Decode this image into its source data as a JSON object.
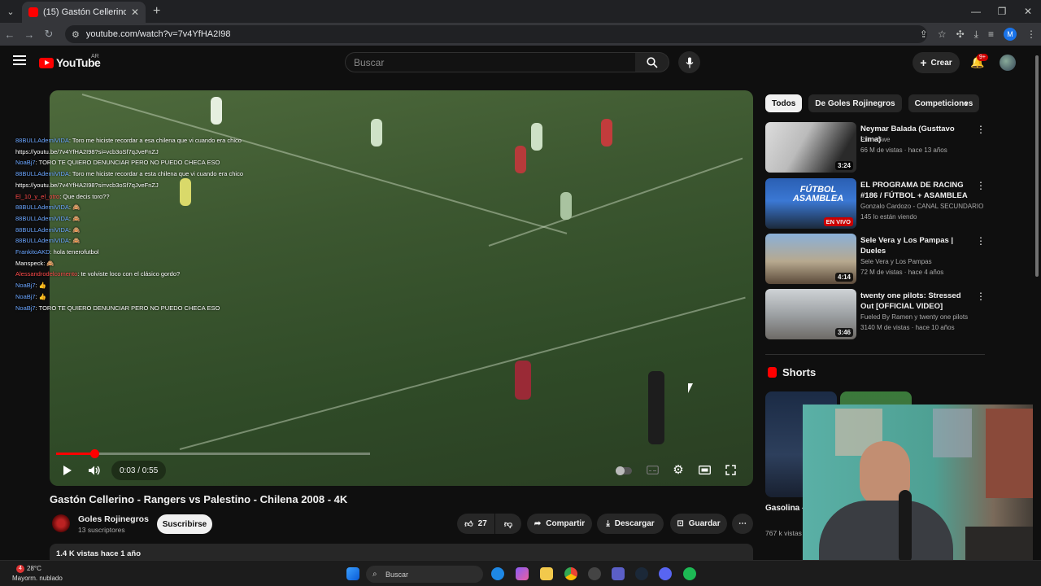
{
  "browser": {
    "tab_title": "(15) Gastón Cellerino - Rangers",
    "url": "youtube.com/watch?v=7v4YfHA2I98",
    "profile_initial": "M"
  },
  "header": {
    "logo_text": "YouTube",
    "region": "AR",
    "search_placeholder": "Buscar",
    "create_label": "Crear",
    "notifications_badge": "9+"
  },
  "player": {
    "time": "0:03 / 0:55",
    "progress_fraction": 0.055,
    "buffered_fraction": 0.45,
    "chat": [
      {
        "user": "88BULLAdemiVIDA",
        "user_color": "blue",
        "text": ": Toro me hiciste recordar a esa chilena que vi cuando era chico https://youtu.be/7v4YfHA2I98?si=vcb3oSf7qJveFnZJ"
      },
      {
        "user": "NoaBj7",
        "user_color": "blue",
        "text": ": TORO TE QUIERO DENUNCIAR PERO NO PUEDO CHECA ESO"
      },
      {
        "user": "88BULLAdemiVIDA",
        "user_color": "blue",
        "text": ": Toro me hiciste recordar a esta chilena que vi cuando era chico https://youtu.be/7v4YfHA2I98?si=vcb3oSf7qJveFnZJ"
      },
      {
        "user": "El_10_y_el_otro",
        "user_color": "red",
        "text": ": Que decis toro??"
      },
      {
        "user": "88BULLAdemiVIDA",
        "user_color": "blue",
        "text": ": 🙈"
      },
      {
        "user": "88BULLAdemiVIDA",
        "user_color": "blue",
        "text": ": 🙈"
      },
      {
        "user": "88BULLAdemiVIDA",
        "user_color": "blue",
        "text": ": 🙈"
      },
      {
        "user": "88BULLAdemiVIDA",
        "user_color": "blue",
        "text": ": 🙈"
      },
      {
        "user": "FrankitoAKD",
        "user_color": "blue",
        "text": ": hola tenerofutbol"
      },
      {
        "user": "Manspeck",
        "user_color": "white",
        "text": ": 🙈"
      },
      {
        "user": "Alessandrodelcomento",
        "user_color": "red",
        "text": ": te volviste loco con el clásico gordo?"
      },
      {
        "user": "NoaBj7",
        "user_color": "blue",
        "text": ": 👍"
      },
      {
        "user": "NoaBj7",
        "user_color": "blue",
        "text": ": 👍"
      },
      {
        "user": "NoaBj7",
        "user_color": "blue",
        "text": ": TORO TE QUIERO DENUNCIAR PERO NO PUEDO CHECA ESO"
      }
    ]
  },
  "video": {
    "title": "Gastón Cellerino - Rangers vs Palestino - Chilena 2008 - 4K",
    "channel": "Goles Rojinegros",
    "subscribers": "13 suscriptores",
    "subscribe_label": "Suscribirse",
    "likes": "27",
    "share_label": "Compartir",
    "download_label": "Descargar",
    "save_label": "Guardar",
    "views_date": "1.4 K vistas  hace 1 año"
  },
  "sidebar": {
    "chips": [
      "Todos",
      "De Goles Rojinegros",
      "Competiciones"
    ],
    "recommendations": [
      {
        "title": "Neymar Balada (Gusttavo Lima)",
        "channel": "PrimeSwe",
        "meta": "66 M de vistas · hace 13 años",
        "duration": "3:24"
      },
      {
        "title": "EL PROGRAMA DE RACING #186 / FÚTBOL + ASAMBLEA",
        "channel": "Gonzalo Cardozo - CANAL SECUNDARIO",
        "meta": "145 lo están viendo",
        "duration": "EN VIVO",
        "thumb_text": "FÚTBOL ASAMBLEA"
      },
      {
        "title": "Sele Vera y Los Pampas | Dueles",
        "channel": "Sele Vera y Los Pampas",
        "meta": "72 M de vistas · hace 4 años",
        "duration": "4:14"
      },
      {
        "title": "twenty one pilots: Stressed Out [OFFICIAL VIDEO]",
        "channel": "Fueled By Ramen y twenty one pilots",
        "meta": "3140 M de vistas · hace 10 años",
        "duration": "3:46"
      }
    ],
    "shorts_label": "Shorts",
    "short": {
      "title": "Gasolina - Dance Sta",
      "views": "767 k vistas"
    }
  },
  "taskbar": {
    "temperature": "28°C",
    "weather": "Mayorm. nublado",
    "notification_count": "4",
    "search_label": "Buscar"
  }
}
